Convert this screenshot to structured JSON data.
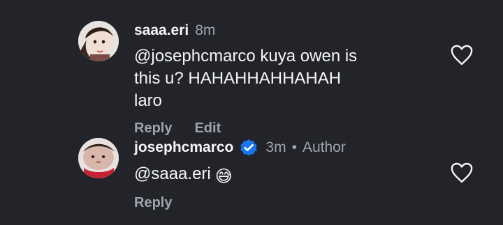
{
  "comments": [
    {
      "username": "saaa.eri",
      "time": "8m",
      "text_mention": "@josephcmarco",
      "text_body": " kuya owen is this u? HAHAHHAHHAHAH laro",
      "actions": {
        "reply": "Reply",
        "edit": "Edit"
      },
      "icon": "heart-outline"
    },
    {
      "username": "josephcmarco",
      "verified_icon": "verified-badge",
      "time": "3m",
      "dot": "•",
      "author": "Author",
      "text_mention": "@saaa.eri",
      "emoji": "😅",
      "actions": {
        "reply": "Reply"
      },
      "icon": "heart-outline"
    }
  ],
  "colors": {
    "background": "#222429",
    "primary_text": "#f4f6f8",
    "secondary_text": "#9ea4ad",
    "verified": "#1877f2"
  }
}
